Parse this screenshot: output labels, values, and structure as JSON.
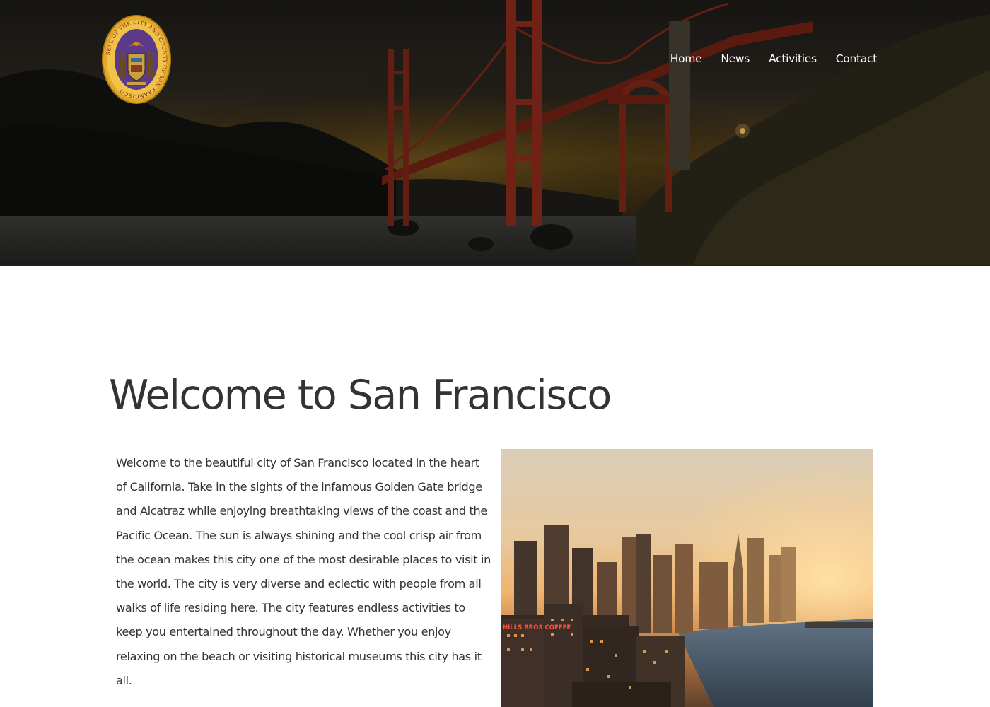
{
  "nav": {
    "items": [
      {
        "label": "Home"
      },
      {
        "label": "News"
      },
      {
        "label": "Activities"
      },
      {
        "label": "Contact"
      }
    ]
  },
  "seal": {
    "ring_text": "SEAL OF THE CITY AND COUNTY OF SAN FRANCISCO"
  },
  "main": {
    "title": "Welcome to San Francisco",
    "paragraph": "Welcome to the beautiful city of San Francisco located in the heart of California. Take in the sights of the infamous Golden Gate bridge and Alcatraz while enjoying breathtaking views of the coast and the Pacific Ocean. The sun is always shining and the cool crisp air from the ocean makes this city one of the most desirable places to visit in the world. The city is very diverse and eclectic with people from all walks of life residing here. The city features endless activities to keep you entertained throughout the day. Whether you enjoy relaxing on the beach or visiting historical museums this city has it all."
  },
  "photo": {
    "sign_text": "HILLS BROS COFFEE"
  },
  "colors": {
    "text": "#333333",
    "nav_text": "#ffffff",
    "bridge": "#8a2a1c",
    "seal_gold": "#e0a92b",
    "seal_purple": "#5b3a8c"
  }
}
